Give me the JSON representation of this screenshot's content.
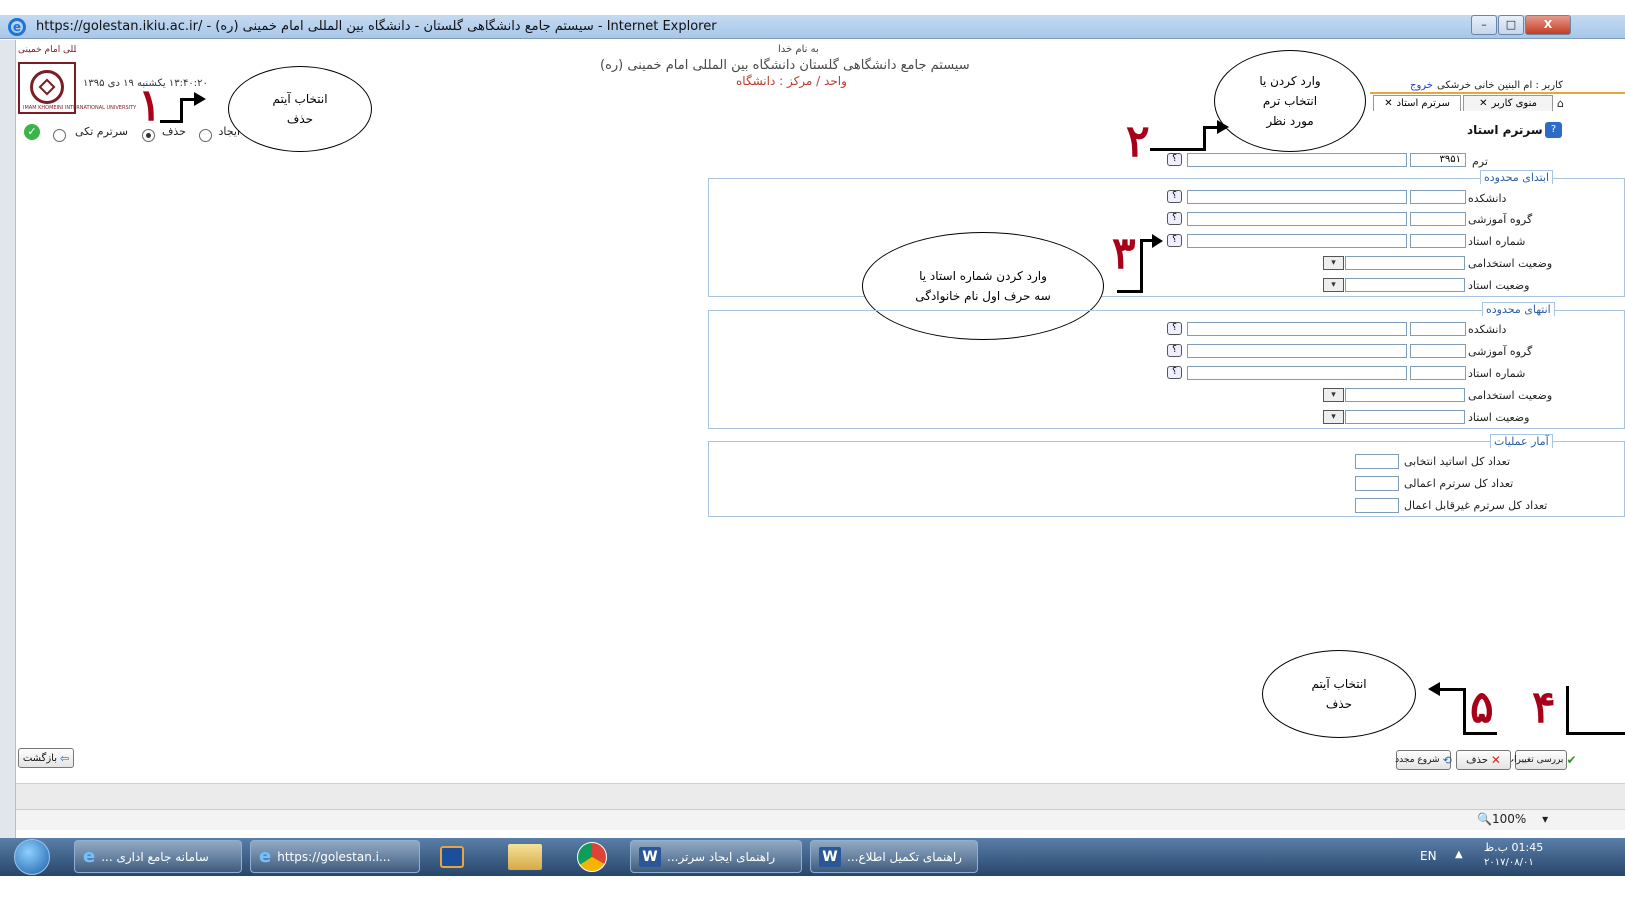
{
  "window": {
    "title": "https://golestan.ikiu.ac.ir/ - (سیستم جامع دانشگاهی گلستان - دانشگاه بین المللی امام خمینی (ره - Internet Explorer",
    "minimize": "–",
    "maximize": "□",
    "close": "X"
  },
  "header": {
    "bismillah": "به نام خدا",
    "system_title": "سیستم جامع دانشگاهی گلستان  دانشگاه بین المللی امام خمینی (ره)",
    "unit": "واحد / مرکز : دانشگاه",
    "datetime": "۱۳:۴۰:۲۰ یکشنبه ۱۹ دی ۱۳۹۵",
    "logo_text": "دانشگاه بین‌المللی امام خمینی",
    "logo_caption": "IMAM KHOMEINI INTERNATIONAL UNIVERSITY",
    "user_label": "کاربر : ام البنین خانی خرشکی",
    "logout": "خروج"
  },
  "mode_radios": [
    {
      "label": "سرترم تکی",
      "selected": false
    },
    {
      "label": "حذف",
      "selected": true
    },
    {
      "label": "ایجاد",
      "selected": false
    }
  ],
  "tabs": [
    {
      "label": "منوی کاربر",
      "close": "✕"
    },
    {
      "label": "سرترم استاد",
      "close": "✕"
    }
  ],
  "page_title": "سرترم استاد",
  "form": {
    "term_label": "ترم",
    "term_value": "۳۹۵۱",
    "range_start": {
      "legend": "ابتدای محدوده",
      "faculty": "دانشکده",
      "group": "گروه آموزشی",
      "teacher_no": "شماره استاد",
      "employment": "وضعیت استخدامی",
      "teacher_status": "وضعیت استاد"
    },
    "range_end": {
      "legend": "انتهای محدوده",
      "faculty": "دانشکده",
      "group": "گروه آموزشی",
      "teacher_no": "شماره استاد",
      "employment": "وضعیت استخدامی",
      "teacher_status": "وضعیت استاد"
    },
    "stats": {
      "legend": "آمار عملیات",
      "selected_teachers": "تعداد کل اساتید انتخابی",
      "applied": "تعداد کل سرترم اعمالی",
      "not_applicable": "تعداد کل سرترم غیرقابل اعمال"
    },
    "q": "؟",
    "dropdown": "▾"
  },
  "callouts": {
    "c1": "انتخاب آیتم\nحذف",
    "c2": "وارد کردن یا\nانتخاب  ترم\nمورد نظر",
    "c3": "وارد کردن شماره استاد یا\nسه حرف اول نام خانوادگی",
    "c4": "انتخاب آیتم\nحذف"
  },
  "step_numbers": {
    "n1": "۱",
    "n2": "۲",
    "n3": "۳",
    "n4": "۴",
    "n5": "۵"
  },
  "buttons": {
    "review": "بررسی تغییرات",
    "delete": "حذف",
    "restart": "شروع مجدد",
    "back": "بازگشت"
  },
  "status": {
    "zoom": "100%",
    "zoom_arrow": "▾"
  },
  "taskbar": {
    "items": [
      {
        "label": "سامانه جامع اداری ..."
      },
      {
        "label": "https://golestan.i..."
      },
      {
        "label": ""
      },
      {
        "label": ""
      },
      {
        "label": ""
      },
      {
        "label": "راهنمای ایجاد سرتر..."
      },
      {
        "label": "راهنمای تکمیل اطلاع..."
      }
    ],
    "lang": "EN",
    "time": "01:45 ب.ظ",
    "date": "۲۰۱۷/۰۸/۰۱"
  },
  "colors": {
    "accent_red": "#a80018",
    "legend_blue": "#2a5fa8",
    "logo_maroon": "#7a1d24"
  }
}
